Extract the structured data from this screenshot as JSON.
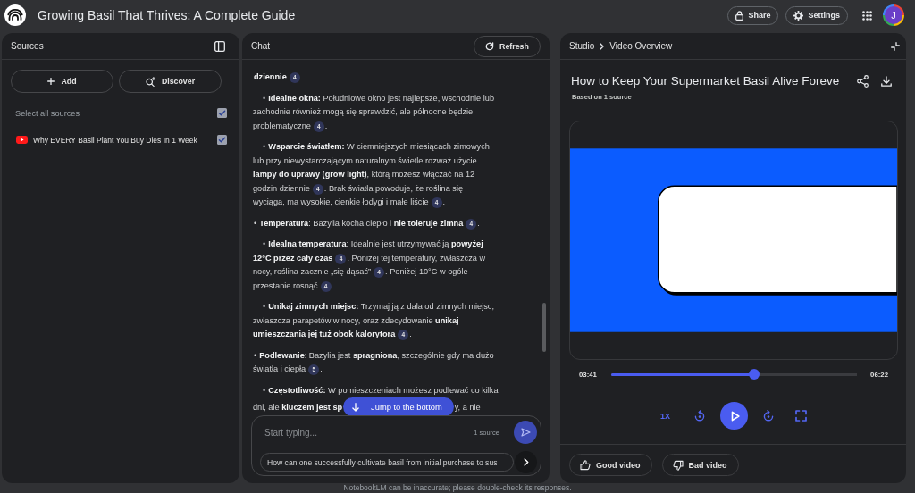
{
  "top_bar": {
    "title": "Growing Basil That Thrives: A Complete Guide",
    "buttons": [
      {
        "label": "Share",
        "kind": "share"
      },
      {
        "label": "Settings",
        "kind": "settings"
      }
    ],
    "avatar_letter": "J"
  },
  "sources": {
    "title": "Sources",
    "actions": [
      {
        "label": "Add",
        "kind": "add"
      },
      {
        "label": "Discover",
        "kind": "discover"
      }
    ],
    "select_all": {
      "label": "Select all sources",
      "checked": true
    },
    "items": [
      {
        "title": "Why EVERY Basil Plant You Buy Dies In 1 Week",
        "checked": true
      }
    ]
  },
  "chat": {
    "title": "Chat",
    "refresh_label": "Refresh",
    "jump_label": "Jump to the bottom",
    "messages": [
      {
        "parts": [
          {
            "kind": "text",
            "text": "**dziennie**"
          },
          {
            "kind": "cite",
            "text": "4"
          },
          {
            "kind": "text",
            "text": "."
          }
        ],
        "children": [
          {
            "bullet": "•",
            "parts": [
              {
                "kind": "text",
                "text": "**Idealne okna:** Południowe okno jest najlepsze, wschodnie lub zachodnie również mogą się sprawdzić, ale północne będzie problematyczne"
              },
              {
                "kind": "cite",
                "text": "4"
              },
              {
                "kind": "text",
                "text": "."
              }
            ]
          },
          {
            "bullet": "•",
            "parts": [
              {
                "kind": "text",
                "text": "**Wsparcie światłem:** W ciemniejszych miesiącach zimowych lub przy niewystarczającym naturalnym świetle rozważ użycie **lampy do uprawy (grow light)**, którą możesz włączać na 12 godzin dziennie"
              },
              {
                "kind": "cite",
                "text": "4"
              },
              {
                "kind": "text",
                "text": ". Brak światła powoduje, że roślina się wyciąga, ma wysokie, cienkie łodygi i małe liście"
              },
              {
                "kind": "cite",
                "text": "4"
              },
              {
                "kind": "text",
                "text": "."
              }
            ]
          }
        ]
      },
      {
        "bullet": "•",
        "parts": [
          {
            "kind": "text",
            "text": "**Temperatura**: Bazylia kocha ciepło i **nie toleruje zimna**"
          },
          {
            "kind": "cite",
            "text": "4"
          },
          {
            "kind": "text",
            "text": "."
          }
        ],
        "children": [
          {
            "bullet": "•",
            "parts": [
              {
                "kind": "text",
                "text": "**Idealna temperatura**: Idealnie jest utrzymywać ją **powyżej 12°C przez cały czas**"
              },
              {
                "kind": "cite",
                "text": "4"
              },
              {
                "kind": "text",
                "text": ". Poniżej tej temperatury, zwłaszcza w nocy, roślina zacznie „się dąsać”"
              },
              {
                "kind": "cite",
                "text": "4"
              },
              {
                "kind": "text",
                "text": ". Poniżej 10°C w ogóle przestanie rosnąć"
              },
              {
                "kind": "cite",
                "text": "4"
              },
              {
                "kind": "text",
                "text": "."
              }
            ]
          },
          {
            "bullet": "•",
            "parts": [
              {
                "kind": "text",
                "text": "**Unikaj zimnych miejsc:** Trzymaj ją z dala od zimnych miejsc, zwłaszcza parapetów w nocy, oraz zdecydowanie **unikaj umieszczania jej tuż obok kalorytora**"
              },
              {
                "kind": "cite",
                "text": "4"
              },
              {
                "kind": "text",
                "text": "."
              }
            ]
          }
        ]
      },
      {
        "bullet": "•",
        "parts": [
          {
            "kind": "text",
            "text": "**Podlewanie**: Bazylia jest **spragniona**, szczególnie gdy ma dużo światła i ciepła"
          },
          {
            "kind": "cite",
            "text": "5"
          },
          {
            "kind": "text",
            "text": "."
          }
        ],
        "children": [
          {
            "bullet": "•",
            "parts": [
              {
                "kind": "text",
                "text": "**Częstotliwość:** W pomieszczeniach możesz podlewać co kilka"
              }
            ],
            "covered_line": [
              {
                "kind": "text",
                "text": "dni, ale **kluczem jest sp**"
              },
              {
                "kind": "jump"
              },
              {
                "kind": "text",
                "text": "y, a nie"
              }
            ]
          }
        ]
      }
    ],
    "input": {
      "placeholder": "Start typing...",
      "source_count": "1 source"
    },
    "suggestion": "How can one successfully cultivate basil from initial purchase to sus"
  },
  "studio": {
    "breadcrumb": [
      "Studio",
      "Video Overview"
    ],
    "title": "How to Keep Your Supermarket Basil Alive Foreve",
    "subtitle": "Based on 1 source",
    "player": {
      "elapsed": "03:41",
      "duration": "06:22",
      "level": 0.58,
      "speed": "1X",
      "playing": false
    },
    "feedback": [
      {
        "label": "Good video",
        "kind": "good"
      },
      {
        "label": "Bad video",
        "kind": "bad"
      }
    ]
  },
  "footer": "NotebookLM can be inaccurate; please double-check its responses."
}
